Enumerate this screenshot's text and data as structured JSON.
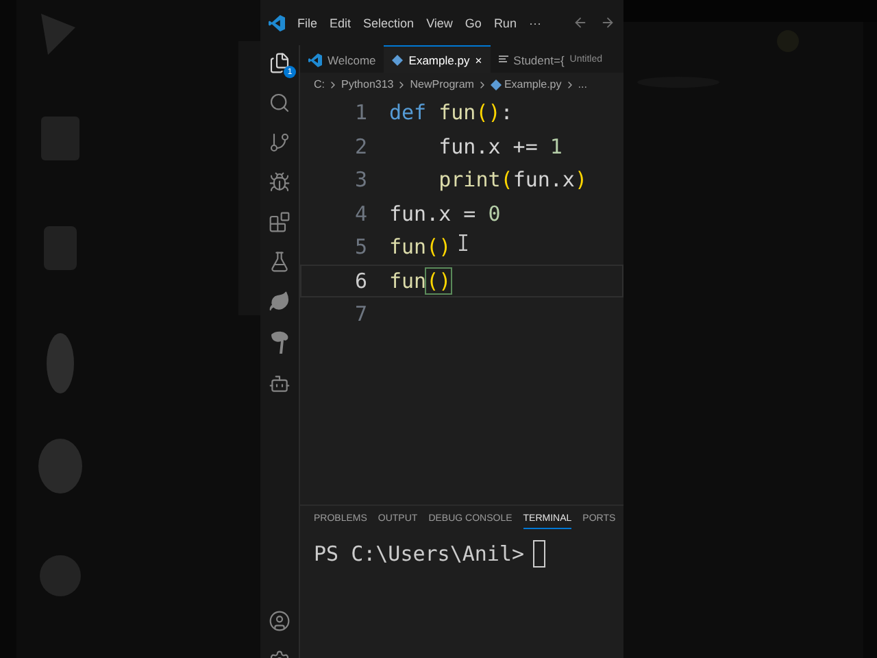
{
  "menu": [
    "File",
    "Edit",
    "Selection",
    "View",
    "Go",
    "Run",
    "···"
  ],
  "tabs": [
    {
      "label": "Welcome",
      "kind": "welcome",
      "selected": false
    },
    {
      "label": "Example.py",
      "kind": "python",
      "selected": true,
      "close": "×"
    },
    {
      "label": "Student={",
      "kind": "plain",
      "selected": false,
      "detail": "Untitled"
    }
  ],
  "explorer_badge": "1",
  "breadcrumb": [
    "C:",
    "Python313",
    "NewProgram",
    "Example.py",
    "..."
  ],
  "code_lines": [
    {
      "number": "1",
      "current": false,
      "tokens": [
        {
          "text": "def ",
          "kind": "keyword"
        },
        {
          "text": "fun",
          "kind": "func"
        },
        {
          "text": "()",
          "kind": "paren"
        },
        {
          "text": ":",
          "kind": "plain"
        }
      ]
    },
    {
      "number": "2",
      "current": false,
      "tokens": [
        {
          "text": "    fun.x += ",
          "kind": "plain"
        },
        {
          "text": "1",
          "kind": "number"
        }
      ]
    },
    {
      "number": "3",
      "current": false,
      "tokens": [
        {
          "text": "    print",
          "kind": "func"
        },
        {
          "text": "(",
          "kind": "paren"
        },
        {
          "text": "fun.x",
          "kind": "plain"
        },
        {
          "text": ")",
          "kind": "paren"
        }
      ]
    },
    {
      "number": "4",
      "current": false,
      "tokens": [
        {
          "text": "fun.x = ",
          "kind": "plain"
        },
        {
          "text": "0",
          "kind": "number"
        }
      ]
    },
    {
      "number": "5",
      "current": false,
      "tokens": [
        {
          "text": "fun",
          "kind": "func"
        },
        {
          "text": "()",
          "kind": "paren"
        }
      ]
    },
    {
      "number": "6",
      "current": true,
      "tokens": [
        {
          "text": "fun",
          "kind": "func"
        },
        {
          "text": "()",
          "kind": "paren",
          "matched": true
        }
      ]
    },
    {
      "number": "7",
      "current": false
    }
  ],
  "panel_tabs": [
    {
      "label": "PROBLEMS",
      "selected": false
    },
    {
      "label": "OUTPUT",
      "selected": false
    },
    {
      "label": "DEBUG CONSOLE",
      "selected": false
    },
    {
      "label": "TERMINAL",
      "selected": true
    },
    {
      "label": "PORTS",
      "selected": false
    }
  ],
  "terminal": {
    "prompt": "PS C:\\Users\\Anil>"
  }
}
